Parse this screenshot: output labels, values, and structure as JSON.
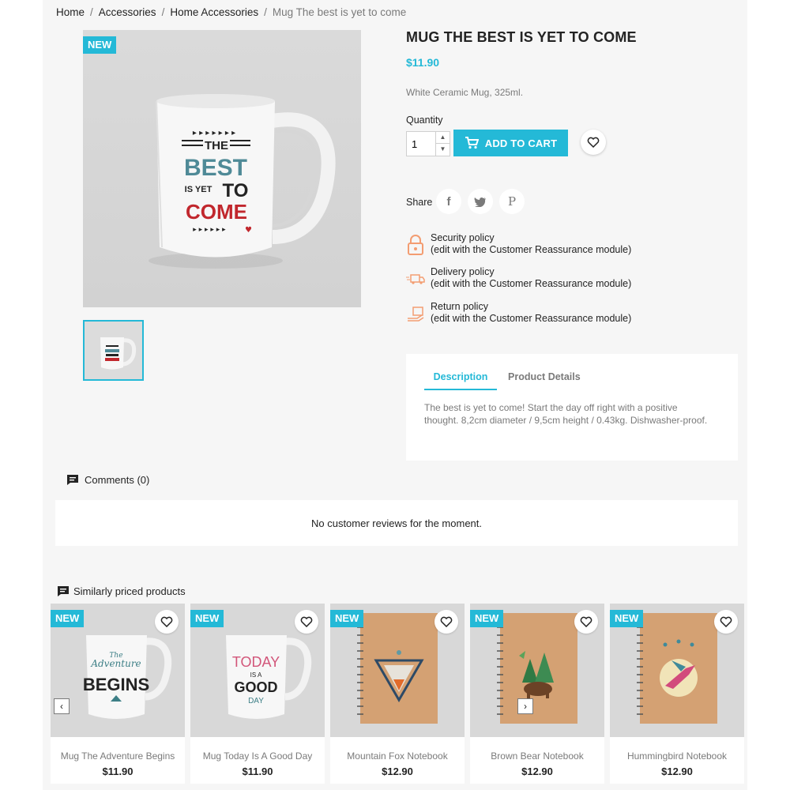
{
  "breadcrumb": [
    "Home",
    "Accessories",
    "Home Accessories",
    "Mug The best is yet to come"
  ],
  "product": {
    "badge": "NEW",
    "title": "MUG THE BEST IS YET TO COME",
    "price": "$11.90",
    "short_description": "White Ceramic Mug, 325ml.",
    "quantity_label": "Quantity",
    "quantity_value": "1",
    "add_to_cart": "ADD TO CART",
    "share_label": "Share",
    "mug_art": {
      "line1": "THE",
      "line2": "BEST",
      "line3a": "IS YET",
      "line3b": "TO",
      "line4": "COME"
    }
  },
  "policies": [
    {
      "title": "Security policy",
      "note": "(edit with the Customer Reassurance module)"
    },
    {
      "title": "Delivery policy",
      "note": "(edit with the Customer Reassurance module)"
    },
    {
      "title": "Return policy",
      "note": "(edit with the Customer Reassurance module)"
    }
  ],
  "tabs": {
    "description": "Description",
    "details": "Product Details",
    "description_text": "The best is yet to come! Start the day off right with a positive thought. 8,2cm diameter / 9,5cm height / 0.43kg. Dishwasher-proof."
  },
  "comments": {
    "heading": "Comments (0)",
    "empty": "No customer reviews for the moment."
  },
  "similar": {
    "heading": "Similarly priced products",
    "items": [
      {
        "badge": "NEW",
        "name": "Mug The Adventure Begins",
        "price": "$11.90",
        "art": [
          "The",
          "Adventure",
          "BEGINS"
        ]
      },
      {
        "badge": "NEW",
        "name": "Mug Today Is A Good Day",
        "price": "$11.90",
        "art": [
          "TODAY",
          "IS A",
          "GOOD",
          "DAY"
        ]
      },
      {
        "badge": "NEW",
        "name": "Mountain Fox Notebook",
        "price": "$12.90"
      },
      {
        "badge": "NEW",
        "name": "Brown Bear Notebook",
        "price": "$12.90"
      },
      {
        "badge": "NEW",
        "name": "Hummingbird Notebook",
        "price": "$12.90"
      }
    ]
  },
  "colors": {
    "accent": "#24b9d7",
    "text": "#232323",
    "muted": "#7a7a7a",
    "policy_icon": "#f39d72"
  }
}
